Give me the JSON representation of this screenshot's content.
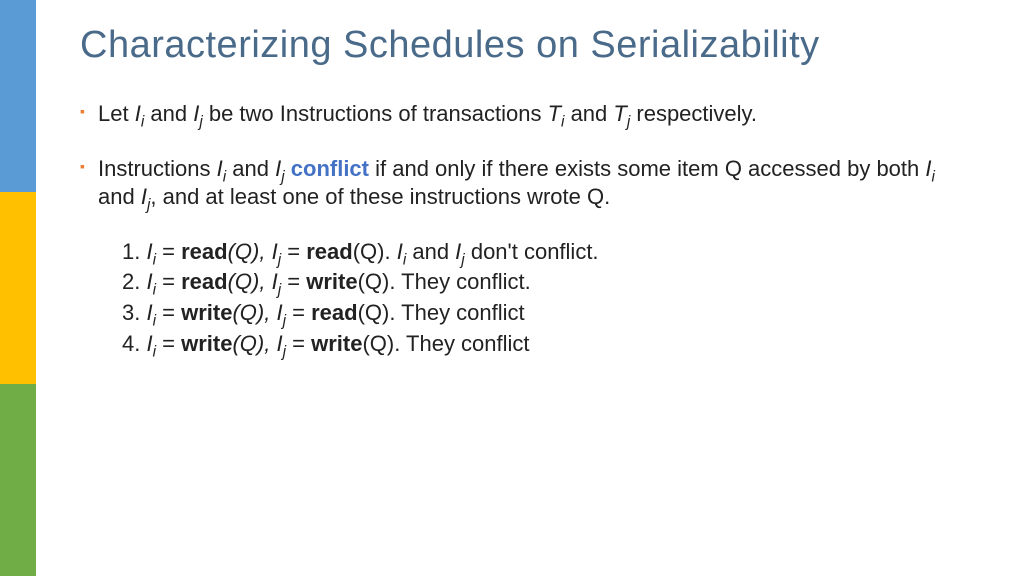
{
  "title": "Characterizing Schedules on Serializability",
  "bullets": {
    "b1_pre": "Let ",
    "b1_Ii": "I",
    "b1_Ii_sub": "i",
    "b1_mid1": " and ",
    "b1_Ij": "I",
    "b1_Ij_sub": "j",
    "b1_mid2": "  be two Instructions of transactions ",
    "b1_Ti": "T",
    "b1_Ti_sub": "i",
    "b1_mid3": " and ",
    "b1_Tj": "T",
    "b1_Tj_sub": "j",
    "b1_post": " respectively.",
    "b2_pre": "Instructions ",
    "b2_Ii": "I",
    "b2_Ii_sub": "i",
    "b2_mid1": " and ",
    "b2_Ij": "I",
    "b2_Ij_sub": "j",
    "b2_sp": " ",
    "b2_conflict": "conflict",
    "b2_mid2": " if and only if there exists some item Q accessed by both ",
    "b2_Ii2": "I",
    "b2_Ii2_sub": "i",
    "b2_mid3": " and ",
    "b2_Ij2": "I",
    "b2_Ij2_sub": "j",
    "b2_post": ", and at least one of these instructions wrote Q."
  },
  "cases": {
    "c1_num": "1. ",
    "c2_num": "2. ",
    "c3_num": "3. ",
    "c4_num": "4. ",
    "Ii": "I",
    "Ii_sub": "i",
    "Ij": "I",
    "Ij_sub": "j",
    "eq": " = ",
    "read": "read",
    "write": "write",
    "Q": "(Q)",
    "Qit": "(Q), ",
    "sep_sp": "  ",
    "dot_sp": ".   ",
    "dot_sp2": ".  ",
    "and": " and ",
    "noconf": " don't conflict.",
    "they_conf_dot": "They conflict.",
    "they_conf": "They conflict"
  }
}
